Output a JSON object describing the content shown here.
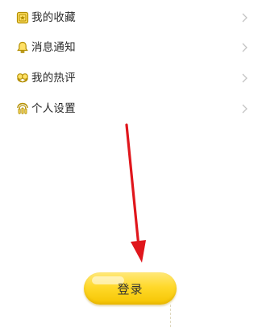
{
  "menu": {
    "items": [
      {
        "label": "我的收藏",
        "icon": "favorites-icon"
      },
      {
        "label": "消息通知",
        "icon": "notification-bell-icon"
      },
      {
        "label": "我的热评",
        "icon": "comments-icon"
      },
      {
        "label": "个人设置",
        "icon": "settings-icon"
      }
    ]
  },
  "login": {
    "label": "登录"
  },
  "colors": {
    "accent": "#ffd92b",
    "icon": "#c9a600",
    "arrow": "#e0161c",
    "chevron": "#c4c4c4"
  }
}
